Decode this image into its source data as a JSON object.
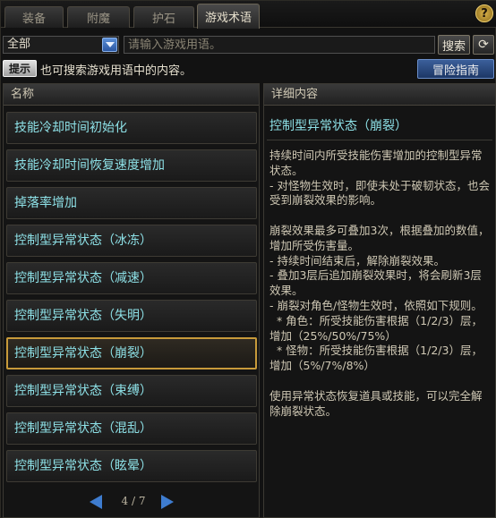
{
  "tabs": [
    {
      "label": "装备",
      "active": false
    },
    {
      "label": "附魔",
      "active": false
    },
    {
      "label": "护石",
      "active": false
    },
    {
      "label": "游戏术语",
      "active": true
    }
  ],
  "help_label": "?",
  "filter": {
    "category_value": "全部",
    "search_placeholder": "请输入游戏用语。",
    "search_button": "搜索",
    "refresh_icon": "⟳"
  },
  "tip": {
    "badge": "提示",
    "text": "也可搜索游戏用语中的内容。",
    "guide_button": "冒险指南"
  },
  "left_panel": {
    "header": "名称",
    "items": [
      "技能冷却时间初始化",
      "技能冷却时间恢复速度增加",
      "掉落率增加",
      "控制型异常状态（冰冻）",
      "控制型异常状态（减速）",
      "控制型异常状态（失明）",
      "控制型异常状态（崩裂）",
      "控制型异常状态（束缚）",
      "控制型异常状态（混乱）",
      "控制型异常状态（眩晕）"
    ],
    "selected_index": 6,
    "pager": "4 / 7"
  },
  "right_panel": {
    "header": "详细内容",
    "title": "控制型异常状态（崩裂）",
    "body": "持续时间内所受技能伤害增加的控制型异常状态。\n- 对怪物生效时，即使未处于破韧状态，也会受到崩裂效果的影响。\n\n崩裂效果最多可叠加3次，根据叠加的数值，增加所受伤害量。\n- 持续时间结束后，解除崩裂效果。\n- 叠加3层后追加崩裂效果时，将会刷新3层效果。\n- 崩裂对角色/怪物生效时，依照如下规则。\n  * 角色：所受技能伤害根据（1/2/3）层，增加（25%/50%/75%）\n  * 怪物：所受技能伤害根据（1/2/3）层，增加（5%/7%/8%）\n\n使用异常状态恢复道具或技能，可以完全解除崩裂状态。"
  }
}
